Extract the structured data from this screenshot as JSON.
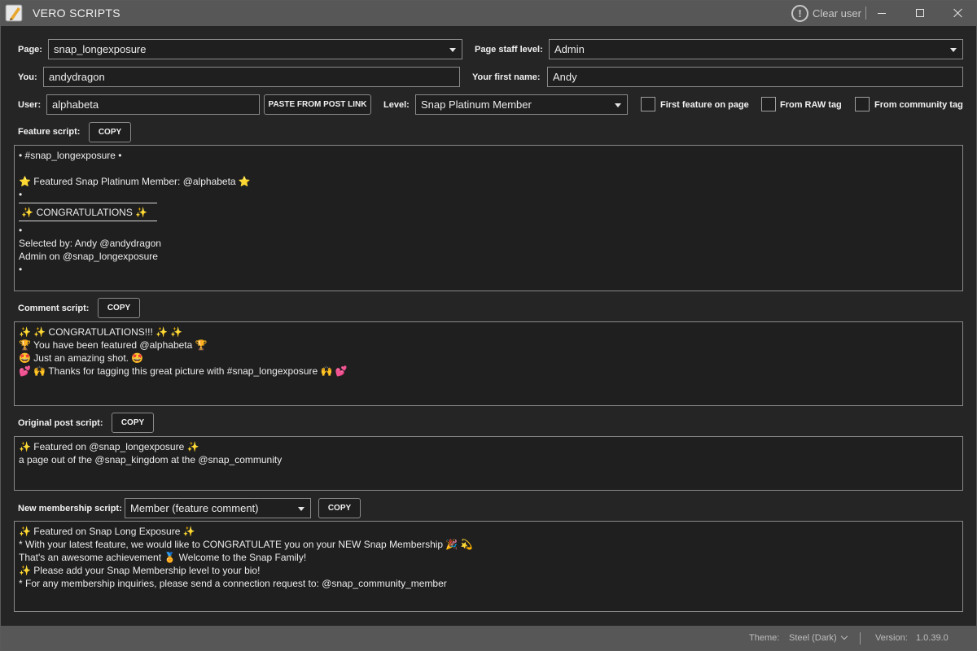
{
  "window": {
    "title": "VERO SCRIPTS",
    "clear_user": "Clear user",
    "info_icon": "!"
  },
  "form": {
    "page_label": "Page:",
    "page_value": "snap_longexposure",
    "staff_label": "Page staff level:",
    "staff_value": "Admin",
    "you_label": "You:",
    "you_value": "andydragon",
    "first_name_label": "Your first name:",
    "first_name_value": "Andy",
    "user_label": "User:",
    "user_value": "alphabeta",
    "paste_button": "PASTE FROM POST LINK",
    "level_label": "Level:",
    "level_value": "Snap Platinum Member",
    "first_feature_label": "First feature on page",
    "raw_tag_label": "From RAW tag",
    "community_tag_label": "From community tag"
  },
  "feature": {
    "label": "Feature script:",
    "copy": "COPY",
    "line1": "• #snap_longexposure •",
    "line2": "⭐ Featured Snap Platinum Member: @alphabeta ⭐",
    "bullet": "•",
    "congrats": " ✨ CONGRATULATIONS ✨",
    "selected_by": "Selected by: Andy @andydragon",
    "admin_on": "Admin on @snap_longexposure"
  },
  "comment": {
    "label": "Comment script:",
    "copy": "COPY",
    "lines": [
      "✨ ✨ CONGRATULATIONS!!! ✨ ✨",
      "🏆 You have been featured @alphabeta 🏆",
      "🤩 Just an amazing shot. 🤩",
      "💕 🙌 Thanks for tagging this great picture with #snap_longexposure 🙌 💕"
    ]
  },
  "original": {
    "label": "Original post script:",
    "copy": "COPY",
    "lines": [
      "✨ Featured on @snap_longexposure ✨",
      "a page out of the @snap_kingdom at the @snap_community"
    ]
  },
  "membership": {
    "label": "New membership script:",
    "select_value": "Member (feature comment)",
    "copy": "COPY",
    "lines": [
      "✨ Featured on Snap Long Exposure ✨",
      "* With your latest feature, we would like to CONGRATULATE you on your NEW Snap Membership 🎉 💫",
      "That's an awesome achievement 🏅 Welcome to the Snap Family!",
      "✨ Please add your Snap Membership level to your bio!",
      "* For any membership inquiries, please send a connection request to: @snap_community_member"
    ]
  },
  "status": {
    "theme_label": "Theme:",
    "theme_value": "Steel (Dark)",
    "version_label": "Version:",
    "version_value": "1.0.39.0"
  }
}
